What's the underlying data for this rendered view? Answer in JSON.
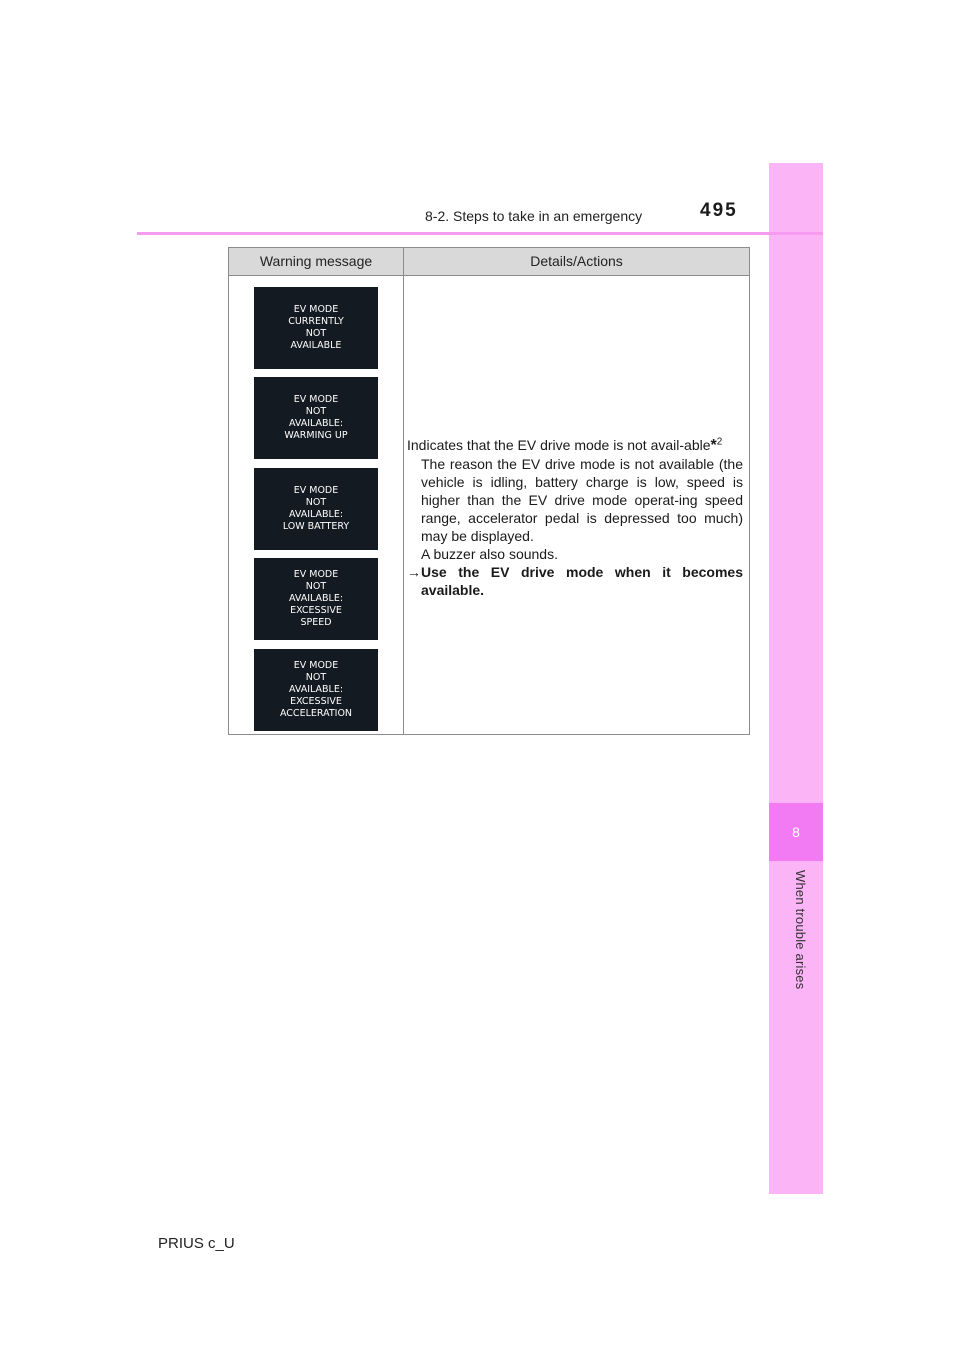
{
  "header": {
    "section_title": "8-2. Steps to take in an emergency",
    "page_number": "495"
  },
  "sidebar": {
    "chapter_number": "8",
    "chapter_title": "When trouble arises"
  },
  "table": {
    "headers": [
      "Warning message",
      "Details/Actions"
    ],
    "messages": [
      "EV MODE\nCURRENTLY\nNOT\nAVAILABLE",
      "EV MODE\nNOT\nAVAILABLE:\nWARMING UP",
      "EV MODE\nNOT\nAVAILABLE:\nLOW BATTERY",
      "EV MODE\nNOT\nAVAILABLE:\nEXCESSIVE\nSPEED",
      "EV MODE\nNOT\nAVAILABLE:\nEXCESSIVE\nACCELERATION"
    ],
    "details": {
      "main": "Indicates that the EV drive mode is not avail-able",
      "footnote_mark": "*",
      "footnote_number": "2",
      "reason": "The reason the EV drive mode is not available (the vehicle is idling, battery charge is low, speed is higher than the EV drive mode operat-ing speed range, accelerator pedal is depressed too much) may be displayed.",
      "buzzer": "A buzzer also sounds.",
      "action_arrow": "→",
      "action": "Use the EV drive mode when it becomes available."
    }
  },
  "footer": {
    "model": "PRIUS c_U"
  }
}
